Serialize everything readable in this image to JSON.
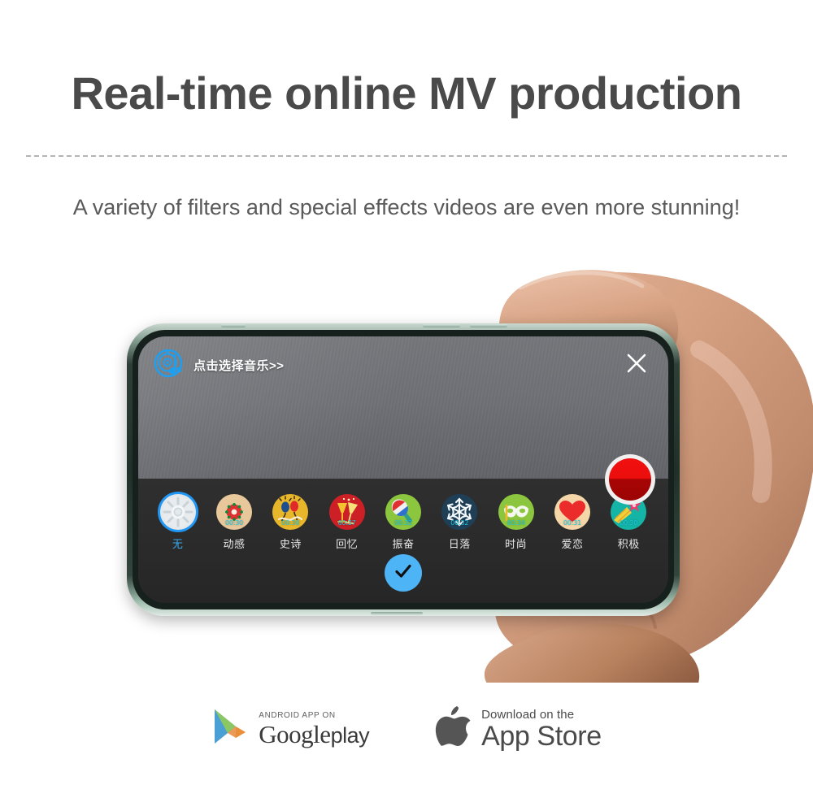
{
  "header": {
    "headline": "Real-time online MV production",
    "subhead": "A variety of filters and special effects videos are even more stunning!"
  },
  "phone": {
    "app": {
      "music_label": "点击选择音乐>>",
      "music_icon": "vinyl-record-note-icon",
      "close_icon": "close-icon",
      "record_icon": "record-button-icon",
      "confirm_icon": "check-icon",
      "accent_blue": "#2196f3",
      "record_red": "#ec0d0d",
      "panel_bg": "#2b2b2b",
      "preview_bg": "#6e7075",
      "filters": [
        {
          "label": "无",
          "duration": "",
          "icon": "cd-disc-icon",
          "bg": "#e4e8ea",
          "selected": true
        },
        {
          "label": "动感",
          "duration": "00:30",
          "icon": "flower-icon",
          "bg": "#e8c79a",
          "selected": false
        },
        {
          "label": "史诗",
          "duration": "00:30",
          "icon": "balloons-icon",
          "bg": "#e8b62a",
          "selected": false
        },
        {
          "label": "回忆",
          "duration": "00:37",
          "icon": "champagne-glasses-icon",
          "bg": "#cc2026",
          "selected": false
        },
        {
          "label": "振奋",
          "duration": "00:32",
          "icon": "maraca-icon",
          "bg": "#8cc63f",
          "selected": false
        },
        {
          "label": "日落",
          "duration": "00:32",
          "icon": "snowflake-icon",
          "bg": "#1f3f57",
          "selected": false
        },
        {
          "label": "时尚",
          "duration": "00:34",
          "icon": "mask-icon",
          "bg": "#8cc63f",
          "selected": false
        },
        {
          "label": "爱恋",
          "duration": "00:31",
          "icon": "heart-icon",
          "bg": "#f5d6a8",
          "selected": false
        },
        {
          "label": "积极",
          "duration": "00:30",
          "icon": "shooting-star-icon",
          "bg": "#14b5a6",
          "selected": false
        }
      ]
    }
  },
  "badges": {
    "google": {
      "small": "ANDROID APP ON",
      "big": "Google",
      "play": "play",
      "icon": "google-play-icon"
    },
    "apple": {
      "small": "Download on the",
      "big": "App Store",
      "icon": "apple-logo-icon"
    }
  }
}
